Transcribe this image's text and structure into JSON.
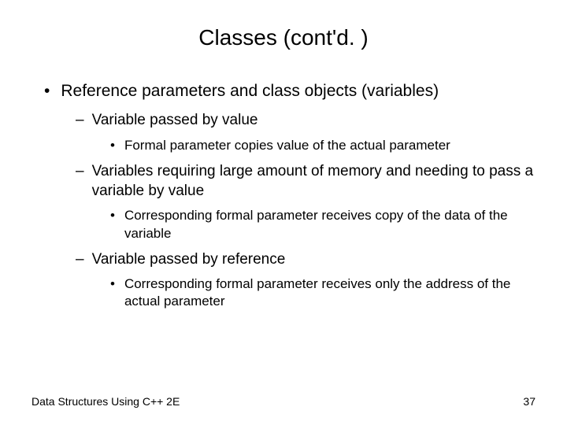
{
  "title": "Classes (cont'd. )",
  "bullets": {
    "l1_0": "Reference parameters and class objects (variables)",
    "l2_0": "Variable passed by value",
    "l3_0": "Formal parameter copies value of the actual parameter",
    "l2_1": "Variables requiring large amount of memory and needing to pass a variable by value",
    "l3_1": "Corresponding formal parameter receives copy of the data of the variable",
    "l2_2": "Variable passed by reference",
    "l3_2": "Corresponding formal parameter receives only the address of the actual parameter"
  },
  "footer": {
    "left": "Data Structures Using C++ 2E",
    "right": "37"
  }
}
